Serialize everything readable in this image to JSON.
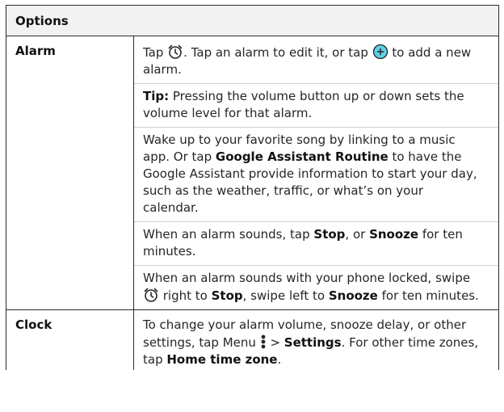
{
  "table": {
    "header": "Options",
    "alarm": {
      "label": "Alarm",
      "p1": {
        "a": "Tap ",
        "b": ". Tap an alarm to edit it, or tap ",
        "c": " to add a new alarm."
      },
      "p2": {
        "bold": "Tip:",
        "rest": " Pressing the volume button up or down sets the volume level for that alarm."
      },
      "p3": {
        "a": "Wake up to your favorite song by linking to a music app. Or tap ",
        "bold": "Google Assistant Routine",
        "b": " to have the Google Assistant provide information to start your day, such as the weather, traffic, or what’s on your calendar."
      },
      "p4": {
        "a": "When an alarm sounds, tap ",
        "stop": "Stop",
        "b": ", or ",
        "snooze": "Snooze",
        "c": " for ten minutes."
      },
      "p5": {
        "a": "When an alarm sounds with your phone locked, swipe ",
        "b": " right to ",
        "stop": "Stop",
        "c": ", swipe left to ",
        "snooze": "Snooze",
        "d": " for ten minutes."
      }
    },
    "clock": {
      "label": "Clock",
      "p1": {
        "a": "To change your alarm volume, snooze delay, or other settings, tap Menu ",
        "b": " > ",
        "settings": "Settings",
        "c": ". For other time zones, tap ",
        "home": "Home time zone",
        "d": "."
      }
    }
  },
  "icons": {
    "alarm": "alarm-clock-icon",
    "add": "add-circle-icon",
    "menu": "menu-dots-icon"
  },
  "colors": {
    "add_icon_fill": "#5fcfe6",
    "border": "#2b2b2b",
    "text": "#262626"
  }
}
